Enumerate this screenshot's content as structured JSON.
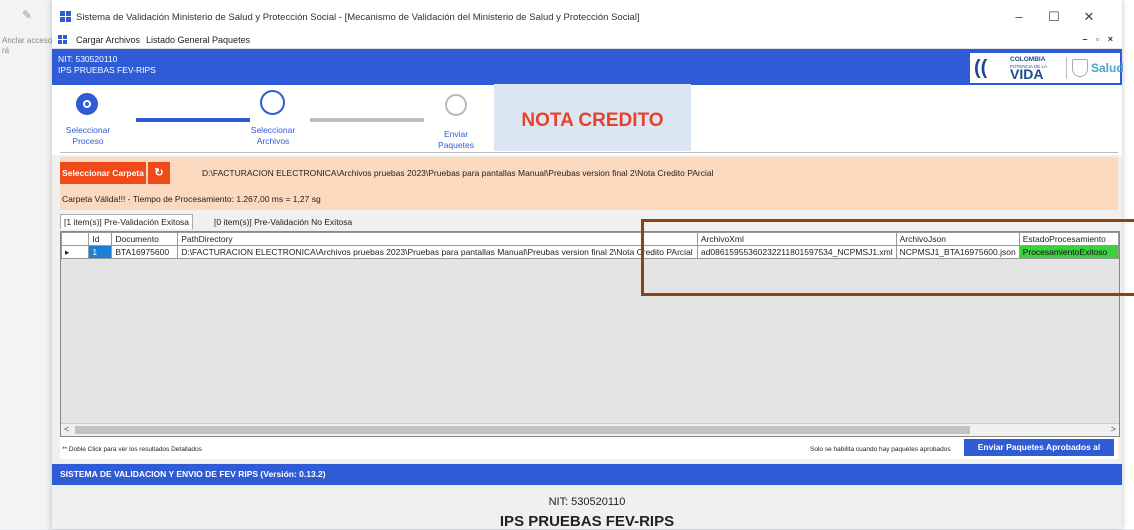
{
  "window": {
    "title": "Sistema de Validación Ministerio de Salud y Protección Social - [Mecanismo de Validación del Ministerio de Salud y Protección Social]",
    "minimize": "–",
    "maximize": "☐",
    "close": "✕"
  },
  "background": {
    "anclar": "Anclar acceso rá"
  },
  "menu": {
    "items": [
      "Cargar Archivos",
      "Listado General Paquetes"
    ],
    "mdi_controls": "– ▫ ×"
  },
  "header": {
    "nit": "NIT: 530520110",
    "ips": "IPS PRUEBAS FEV-RIPS",
    "logo_colombia": "COLOMBIA",
    "logo_potencia": "POTENCIA DE LA",
    "logo_vida": "VIDA",
    "logo_salud": "Salud"
  },
  "wizard": {
    "steps": [
      {
        "line1": "Seleccionar",
        "line2": "Proceso",
        "state": "done"
      },
      {
        "line1": "Seleccionar",
        "line2": "Archivos",
        "state": "current"
      },
      {
        "line1": "Enviar",
        "line2": "Paquetes",
        "state": "pending"
      }
    ],
    "banner": "NOTA CREDITO"
  },
  "folder": {
    "select_button": "Seleccionar Carpeta",
    "refresh_glyph": "↻",
    "path": "D:\\FACTURACION ELECTRONICA\\Archivos pruebas 2023\\Pruebas para pantallas Manual\\Preubas version final 2\\Nota Credito PArcial",
    "status": "Carpeta Válida!!! - Tiempo de Procesamiento: 1.267,00 ms = 1,27 sg"
  },
  "tabs": [
    {
      "label": "[1 item(s)] Pre-Validación Exitosa",
      "active": true
    },
    {
      "label": "[0 item(s)] Pre-Validación No Exitosa",
      "active": false
    }
  ],
  "grid": {
    "columns": [
      "Id",
      "Documento",
      "PathDirectory",
      "ArchivoXml",
      "ArchivoJson",
      "EstadoProcesamiento"
    ],
    "rows": [
      {
        "id": "1",
        "documento": "BTA16975600",
        "path": "D:\\FACTURACION ELECTRONICA\\Archivos pruebas 2023\\Pruebas para pantallas Manual\\Preubas version final 2\\Nota Credito PArcial",
        "xml": "ad08615955360232211801597534_NCPMSJ1.xml",
        "json": "NCPMSJ1_BTA16975600.json",
        "estado": "ProcesamientoExitoso"
      }
    ],
    "row_marker": "▸",
    "scroll_left": "<",
    "scroll_right": ">"
  },
  "footer": {
    "hint": "** Doble Click para ver los resultados Detallados",
    "solo": "Solo se habilita cuando hay paquetes aprobados",
    "send_button": "Enviar Paquetes Aprobados al"
  },
  "version_band": "SISTEMA DE VALIDACION Y ENVIO DE FEV RIPS  (Versión: 0.13.2)",
  "bottom": {
    "nit": "NIT: 530520110",
    "ips": "IPS PRUEBAS FEV-RIPS"
  },
  "colors": {
    "brand_blue": "#2f5cd6",
    "orange": "#f04a1a",
    "peach": "#fbd9bf",
    "success_green": "#3cd13c",
    "annotation": "#8b4513",
    "nota_red": "#e8422c"
  }
}
